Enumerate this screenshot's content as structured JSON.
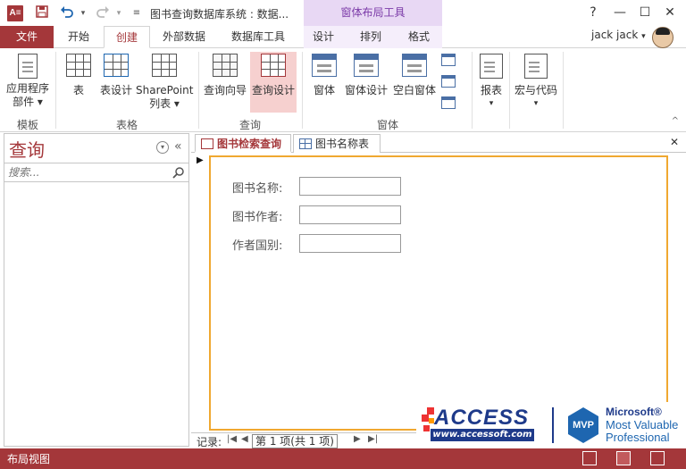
{
  "window": {
    "app_icon": "A≡",
    "title": "图书查询数据库系统 : 数据...",
    "context_tools": "窗体布局工具",
    "help": "?",
    "minimize": "—",
    "restore": "☐",
    "close": "✕"
  },
  "tabs": {
    "file": "文件",
    "home": "开始",
    "create": "创建",
    "external": "外部数据",
    "dbtools": "数据库工具",
    "design": "设计",
    "arrange": "排列",
    "format": "格式"
  },
  "user": {
    "name": "jack jack",
    "dropdown": "▾"
  },
  "ribbon": {
    "templates": {
      "app_parts_1": "应用程序",
      "app_parts_2": "部件 ▾",
      "group": "模板"
    },
    "tables": {
      "table": "表",
      "table_design": "表设计",
      "sharepoint_1": "SharePoint",
      "sharepoint_2": "列表 ▾",
      "group": "表格"
    },
    "queries": {
      "wizard": "查询向导",
      "design": "查询设计",
      "group": "查询"
    },
    "forms": {
      "form": "窗体",
      "form_design": "窗体设计",
      "blank_form": "空白窗体",
      "group": "窗体"
    },
    "reports": {
      "report": "报表",
      "arrow": "▾"
    },
    "macros": {
      "macro": "宏与代码",
      "arrow": "▾"
    }
  },
  "nav": {
    "title": "查询",
    "menu_arrow": "▾",
    "collapse": "«",
    "search_placeholder": "搜索..."
  },
  "doc_tabs": [
    {
      "label": "图书检索查询"
    },
    {
      "label": "图书名称表"
    }
  ],
  "doc_close": "✕",
  "form": {
    "selector": "▶",
    "fields": [
      {
        "label": "图书名称:",
        "value": ""
      },
      {
        "label": "图书作者:",
        "value": ""
      },
      {
        "label": "作者国别:",
        "value": ""
      }
    ]
  },
  "record_nav": {
    "label": "记录:",
    "first": "|◀",
    "prev": "◀",
    "current": "第 1 项(共 1 项)",
    "next": "▶",
    "last": "▶|"
  },
  "logo": {
    "access": "ACCESS",
    "url": "www.accessoft.com",
    "mvp": "MVP",
    "microsoft": "Microsoft®",
    "line1": "Most Valuable",
    "line2": "Professional"
  },
  "status": {
    "text": "布局视图"
  },
  "colors": {
    "accent": "#a4373a",
    "context": "#7b3aa8",
    "highlight": "#f6d0cf",
    "form_border": "#f0a830"
  }
}
